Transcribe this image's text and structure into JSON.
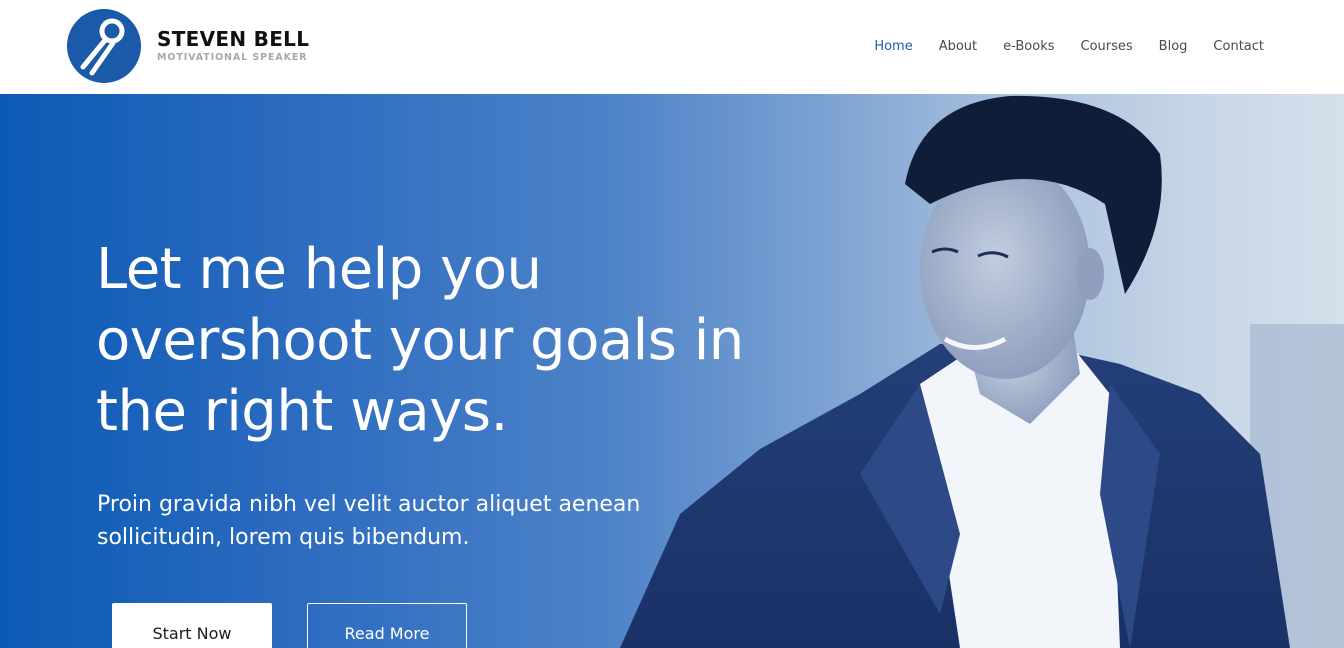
{
  "brand": {
    "name": "STEVEN BELL",
    "tagline": "MOTIVATIONAL SPEAKER",
    "logo_icon": "microphone-icon",
    "color": "#1a5aa8"
  },
  "nav": {
    "items": [
      {
        "label": "Home",
        "active": true
      },
      {
        "label": "About",
        "active": false
      },
      {
        "label": "e-Books",
        "active": false
      },
      {
        "label": "Courses",
        "active": false
      },
      {
        "label": "Blog",
        "active": false
      },
      {
        "label": "Contact",
        "active": false
      }
    ],
    "active_color": "#1f5eab"
  },
  "hero": {
    "headline": "Let me help you overshoot your goals in the right ways.",
    "subhead": "Proin gravida nibh vel velit auctor aliquet aenean sollicitudin, lorem quis bibendum.",
    "primary_button": "Start Now",
    "secondary_button": "Read More",
    "accent_color": "#0b5ab5"
  }
}
